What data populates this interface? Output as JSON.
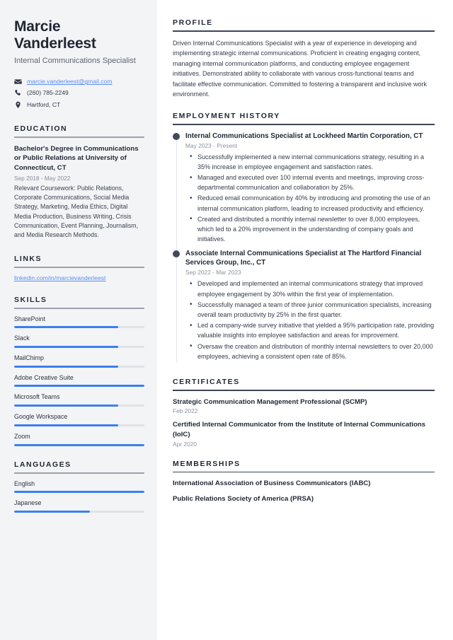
{
  "sidebar": {
    "name": "Marcie Vanderleest",
    "job_title": "Internal Communications Specialist",
    "contact": {
      "email": "marcie.vanderleest@gmail.com",
      "phone": "(260) 785-2249",
      "location": "Hartford, CT",
      "email_icon": "envelope-icon",
      "phone_icon": "phone-icon",
      "location_icon": "map-pin-icon"
    },
    "education": {
      "heading": "EDUCATION",
      "degree": "Bachelor's Degree in Communications or Public Relations at University of Connecticut, CT",
      "date": "Sep 2018 - May 2022",
      "description": "Relevant Coursework: Public Relations, Corporate Communications, Social Media Strategy, Marketing, Media Ethics, Digital Media Production, Business Writing, Crisis Communication, Event Planning, Journalism, and Media Research Methods."
    },
    "links": {
      "heading": "LINKS",
      "items": [
        {
          "label": "linkedin.com/in/marcievanderleest"
        }
      ]
    },
    "skills": {
      "heading": "SKILLS",
      "items": [
        {
          "label": "SharePoint",
          "level": 80
        },
        {
          "label": "Slack",
          "level": 80
        },
        {
          "label": "MailChimp",
          "level": 80
        },
        {
          "label": "Adobe Creative Suite",
          "level": 100
        },
        {
          "label": "Microsoft Teams",
          "level": 80
        },
        {
          "label": "Google Workspace",
          "level": 80
        },
        {
          "label": "Zoom",
          "level": 100
        }
      ]
    },
    "languages": {
      "heading": "LANGUAGES",
      "items": [
        {
          "label": "English",
          "level": 100
        },
        {
          "label": "Japanese",
          "level": 58
        }
      ]
    }
  },
  "main": {
    "profile": {
      "heading": "PROFILE",
      "text": "Driven Internal Communications Specialist with a year of experience in developing and implementing strategic internal communications. Proficient in creating engaging content, managing internal communication platforms, and conducting employee engagement initiatives. Demonstrated ability to collaborate with various cross-functional teams and facilitate effective communication. Committed to fostering a transparent and inclusive work environment."
    },
    "employment": {
      "heading": "EMPLOYMENT HISTORY",
      "jobs": [
        {
          "title": "Internal Communications Specialist at Lockheed Martin Corporation, CT",
          "date": "May 2023 - Present",
          "bullets": [
            "Successfully implemented a new internal communications strategy, resulting in a 35% increase in employee engagement and satisfaction rates.",
            "Managed and executed over 100 internal events and meetings, improving cross-departmental communication and collaboration by 25%.",
            "Reduced email communication by 40% by introducing and promoting the use of an internal communication platform, leading to increased productivity and efficiency.",
            "Created and distributed a monthly internal newsletter to over 8,000 employees, which led to a 20% improvement in the understanding of company goals and initiatives."
          ]
        },
        {
          "title": "Associate Internal Communications Specialist at The Hartford Financial Services Group, Inc., CT",
          "date": "Sep 2022 - Mar 2023",
          "bullets": [
            "Developed and implemented an internal communications strategy that improved employee engagement by 30% within the first year of implementation.",
            "Successfully managed a team of three junior communication specialists, increasing overall team productivity by 25% in the first quarter.",
            "Led a company-wide survey initiative that yielded a 95% participation rate, providing valuable insights into employee satisfaction and areas for improvement.",
            "Oversaw the creation and distribution of monthly internal newsletters to over 20,000 employees, achieving a consistent open rate of 85%."
          ]
        }
      ]
    },
    "certificates": {
      "heading": "CERTIFICATES",
      "items": [
        {
          "title": "Strategic Communication Management Professional (SCMP)",
          "date": "Feb 2022"
        },
        {
          "title": "Certified Internal Communicator from the Institute of Internal Communications (IoIC)",
          "date": "Apr 2020"
        }
      ]
    },
    "memberships": {
      "heading": "MEMBERSHIPS",
      "items": [
        {
          "title": "International Association of Business Communicators (IABC)"
        },
        {
          "title": "Public Relations Society of America (PRSA)"
        }
      ]
    }
  },
  "theme": {
    "accent": "#3b7ff0",
    "link": "#5b8def",
    "sidebar_bg": "#f3f4f6",
    "heading": "#1f2733",
    "muted": "#8c929e"
  }
}
